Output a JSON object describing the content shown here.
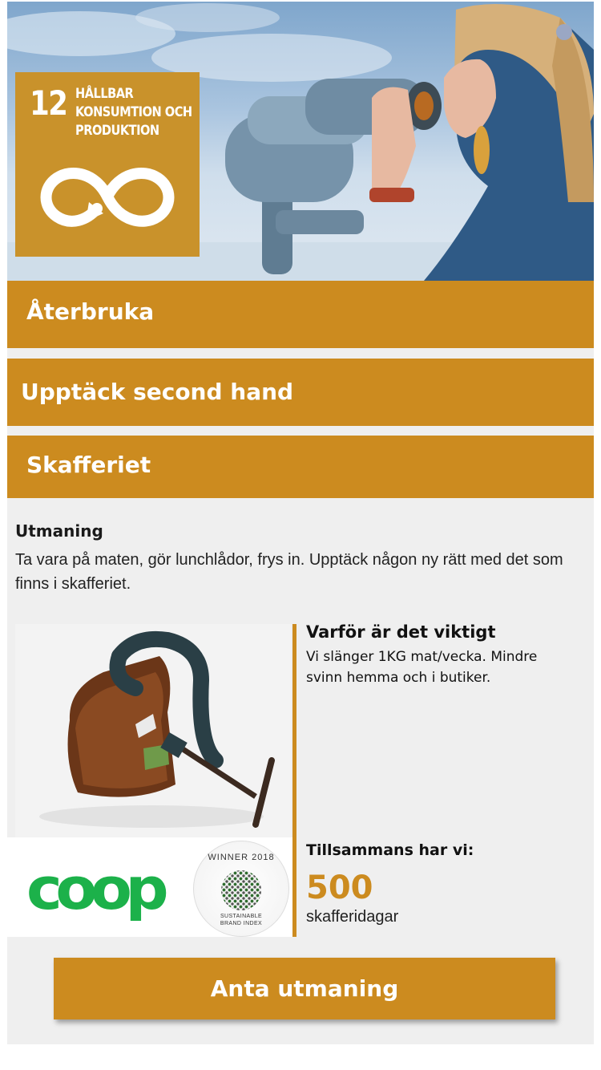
{
  "hero": {
    "sdg_number": "12",
    "sdg_title_lines": [
      "HÅLLBAR",
      "KONSUMTION OCH",
      "PRODUKTION"
    ],
    "sdg_icon": "infinity-arrow-icon"
  },
  "sections": {
    "reuse": "Återbruka",
    "second_hand": "Upptäck second hand",
    "pantry": "Skafferiet"
  },
  "challenge": {
    "title": "Utmaning",
    "description": "Ta vara på maten, gör lunchlådor, frys in. Upptäck någon ny rätt med det som finns i skafferiet."
  },
  "why": {
    "title": "Varför är det viktigt",
    "text": "Vi slänger 1KG mat/vecka. Mindre svinn hemma och i butiker."
  },
  "logos": {
    "coop": "coop",
    "badge_top": "WINNER 2018",
    "badge_line1": "SUSTAINABLE",
    "badge_line2": "BRAND INDEX"
  },
  "together": {
    "label": "Tillsammans har vi:",
    "count": "500",
    "unit": "skafferidagar"
  },
  "cta": {
    "label": "Anta utmaning"
  },
  "colors": {
    "accent": "#cc8b1f",
    "coop_green": "#1cb14a",
    "panel_bg": "#efefef"
  }
}
